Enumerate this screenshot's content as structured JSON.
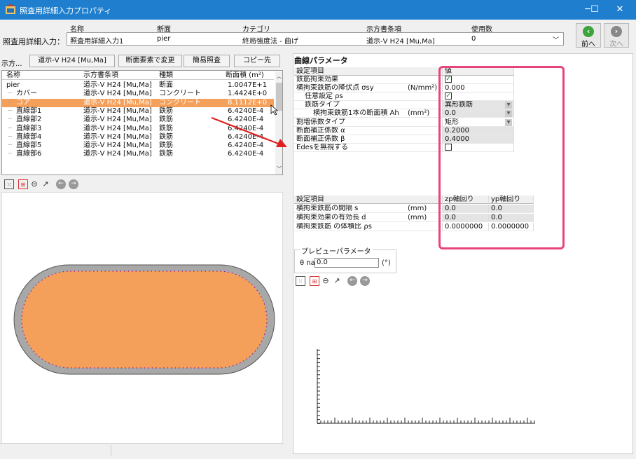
{
  "window": {
    "title": "照査用詳細入力プロパティ",
    "min": "─",
    "max": "☐",
    "close": "✕"
  },
  "header": {
    "row_label": "照査用詳細入力：",
    "columns": [
      "名称",
      "断面",
      "カテゴリ",
      "示方書条項",
      "使用数"
    ],
    "values": [
      "照査用詳細入力1",
      "pier",
      "終局強度法 - 曲げ",
      "道示-V H24 [Mu,Ma]",
      "0"
    ],
    "prev_label": "前へ",
    "next_label": "次へ"
  },
  "left_toolbar": {
    "spec_label": "示方...",
    "spec_value": "道示-V H24 [Mu,Ma]",
    "buttons": [
      "断面要素で変更",
      "簡易照査",
      "コピー先"
    ]
  },
  "list": {
    "columns": [
      "名称",
      "示方書条項",
      "種類",
      "断面積 (m²)"
    ],
    "rows": [
      {
        "name": "pier",
        "spec": "道示-V H24 [Mu,Ma]",
        "kind": "断面",
        "area": "1.0047E+1"
      },
      {
        "name": "カバー",
        "spec": "道示-V H24 [Mu,Ma]",
        "kind": "コンクリート",
        "area": "1.4424E+0"
      },
      {
        "name": "コア",
        "spec": "道示-V H24 [Mu,Ma]",
        "kind": "コンクリート",
        "area": "8.1112E+0"
      },
      {
        "name": "直線部1",
        "spec": "道示-V H24 [Mu,Ma]",
        "kind": "鉄筋",
        "area": "6.4240E-4"
      },
      {
        "name": "直線部2",
        "spec": "道示-V H24 [Mu,Ma]",
        "kind": "鉄筋",
        "area": "6.4240E-4"
      },
      {
        "name": "直線部3",
        "spec": "道示-V H24 [Mu,Ma]",
        "kind": "鉄筋",
        "area": "6.4240E-4"
      },
      {
        "name": "直線部4",
        "spec": "道示-V H24 [Mu,Ma]",
        "kind": "鉄筋",
        "area": "6.4240E-4"
      },
      {
        "name": "直線部5",
        "spec": "道示-V H24 [Mu,Ma]",
        "kind": "鉄筋",
        "area": "6.4240E-4"
      },
      {
        "name": "直線部6",
        "spec": "道示-V H24 [Mu,Ma]",
        "kind": "鉄筋",
        "area": "6.4240E-4"
      }
    ]
  },
  "curve_params": {
    "title": "曲線パラメータ",
    "head": [
      "設定項目",
      "値"
    ],
    "rows": [
      {
        "label": "鉄筋拘束効果",
        "unit": "",
        "value": "",
        "check": true,
        "indent": 0,
        "grey": false
      },
      {
        "label": "横拘束鉄筋の降伏点 σsy",
        "unit": "(N/mm²)",
        "value": "0.000",
        "indent": 0,
        "grey": false
      },
      {
        "label": "任意設定 ρs",
        "unit": "",
        "value": "",
        "check": true,
        "indent": 1,
        "grey": false
      },
      {
        "label": "鉄筋タイプ",
        "unit": "",
        "value": "異形鉄筋",
        "dropdown": true,
        "indent": 1,
        "grey": true
      },
      {
        "label": "横拘束鉄筋1本の断面積 Ah",
        "unit": "(mm²)",
        "value": "0.0",
        "dropdown": true,
        "indent": 2,
        "grey": true
      },
      {
        "label": "割増係数タイプ",
        "unit": "",
        "value": "矩形",
        "dropdown": true,
        "indent": 0,
        "grey": false
      },
      {
        "label": "断面補正係数 α",
        "unit": "",
        "value": "0.2000",
        "indent": 0,
        "grey": true
      },
      {
        "label": "断面補正係数 β",
        "unit": "",
        "value": "0.4000",
        "indent": 0,
        "grey": true
      },
      {
        "label": "Edesを無視する",
        "unit": "",
        "value": "",
        "check": false,
        "indent": 0,
        "grey": false
      }
    ]
  },
  "axis_params": {
    "head": [
      "設定項目",
      "zp軸回り",
      "yp軸回り"
    ],
    "rows": [
      {
        "label": "横拘束鉄筋の間隔 s",
        "unit": "(mm)",
        "zp": "0.0",
        "yp": "0.0",
        "grey": true
      },
      {
        "label": "横拘束効果の有効長 d",
        "unit": "(mm)",
        "zp": "0.0",
        "yp": "0.0",
        "grey": true
      },
      {
        "label": "横拘束鉄筋 の体積比 ρs",
        "unit": "",
        "zp": "0.0000000",
        "yp": "0.0000000",
        "grey": false
      }
    ]
  },
  "preview": {
    "group_label": "プレビューパラメータ",
    "theta_label": "θ na",
    "theta_value": "0.0",
    "unit": "(°)"
  },
  "toolbar_icons": [
    "fit-icon",
    "zoom-window-icon",
    "zoom-out-icon",
    "pan-icon",
    "prev-view-icon",
    "next-view-icon"
  ],
  "colors": {
    "accent": "#1f7fce",
    "core_fill": "#f5a05a",
    "cover_fill": "#a8a8a8",
    "highlight": "#e8447c",
    "rebar": "#a0148c",
    "arrow": "#e02020"
  }
}
